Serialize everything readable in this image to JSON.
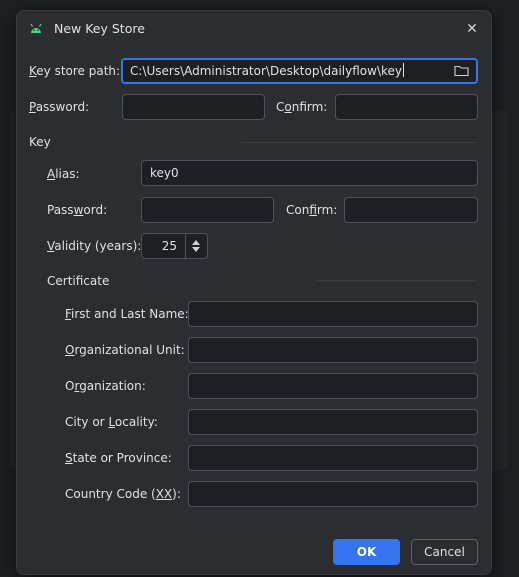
{
  "dialog": {
    "title": "New Key Store",
    "close_glyph": "✕",
    "app_icon": "android-icon"
  },
  "keystore": {
    "path_label_mnemonic": "K",
    "path_label_rest": "ey store path:",
    "path_value": "C:\\Users\\Administrator\\Desktop\\dailyflow\\key",
    "folder_icon": "folder-icon",
    "password_label_mnemonic": "P",
    "password_label_rest": "assword:",
    "password_value": "",
    "confirm_label_pre": "C",
    "confirm_label_mnemonic": "o",
    "confirm_label_rest": "nfirm:",
    "confirm_value": ""
  },
  "key": {
    "section_label": "Key",
    "alias_label_mnemonic": "A",
    "alias_label_rest": "lias:",
    "alias_value": "key0",
    "password_label_pre": "Pass",
    "password_label_mnemonic": "w",
    "password_label_rest": "ord:",
    "password_value": "",
    "confirm_label_pre": "Con",
    "confirm_label_mnemonic": "f",
    "confirm_label_rest": "irm:",
    "confirm_value": "",
    "validity_label_mnemonic": "V",
    "validity_label_rest": "alidity (years):",
    "validity_value": "25"
  },
  "certificate": {
    "section_label": "Certificate",
    "fields": [
      {
        "pre": "",
        "mn": "F",
        "rest": "irst and Last Name:",
        "value": ""
      },
      {
        "pre": "",
        "mn": "O",
        "rest": "rganizational Unit:",
        "value": ""
      },
      {
        "pre": "O",
        "mn": "r",
        "rest": "ganization:",
        "value": ""
      },
      {
        "pre": "City or ",
        "mn": "L",
        "rest": "ocality:",
        "value": ""
      },
      {
        "pre": "",
        "mn": "S",
        "rest": "tate or Province:",
        "value": ""
      },
      {
        "pre": "Country Code (",
        "mn": "XX",
        "rest": "):",
        "value": ""
      }
    ]
  },
  "buttons": {
    "ok_label": "OK",
    "cancel_label": "Cancel"
  },
  "colors": {
    "accent": "#3574f0",
    "dialog_bg": "#2b2d30",
    "field_bg": "#1e1f22",
    "android_green": "#3ddc84"
  }
}
